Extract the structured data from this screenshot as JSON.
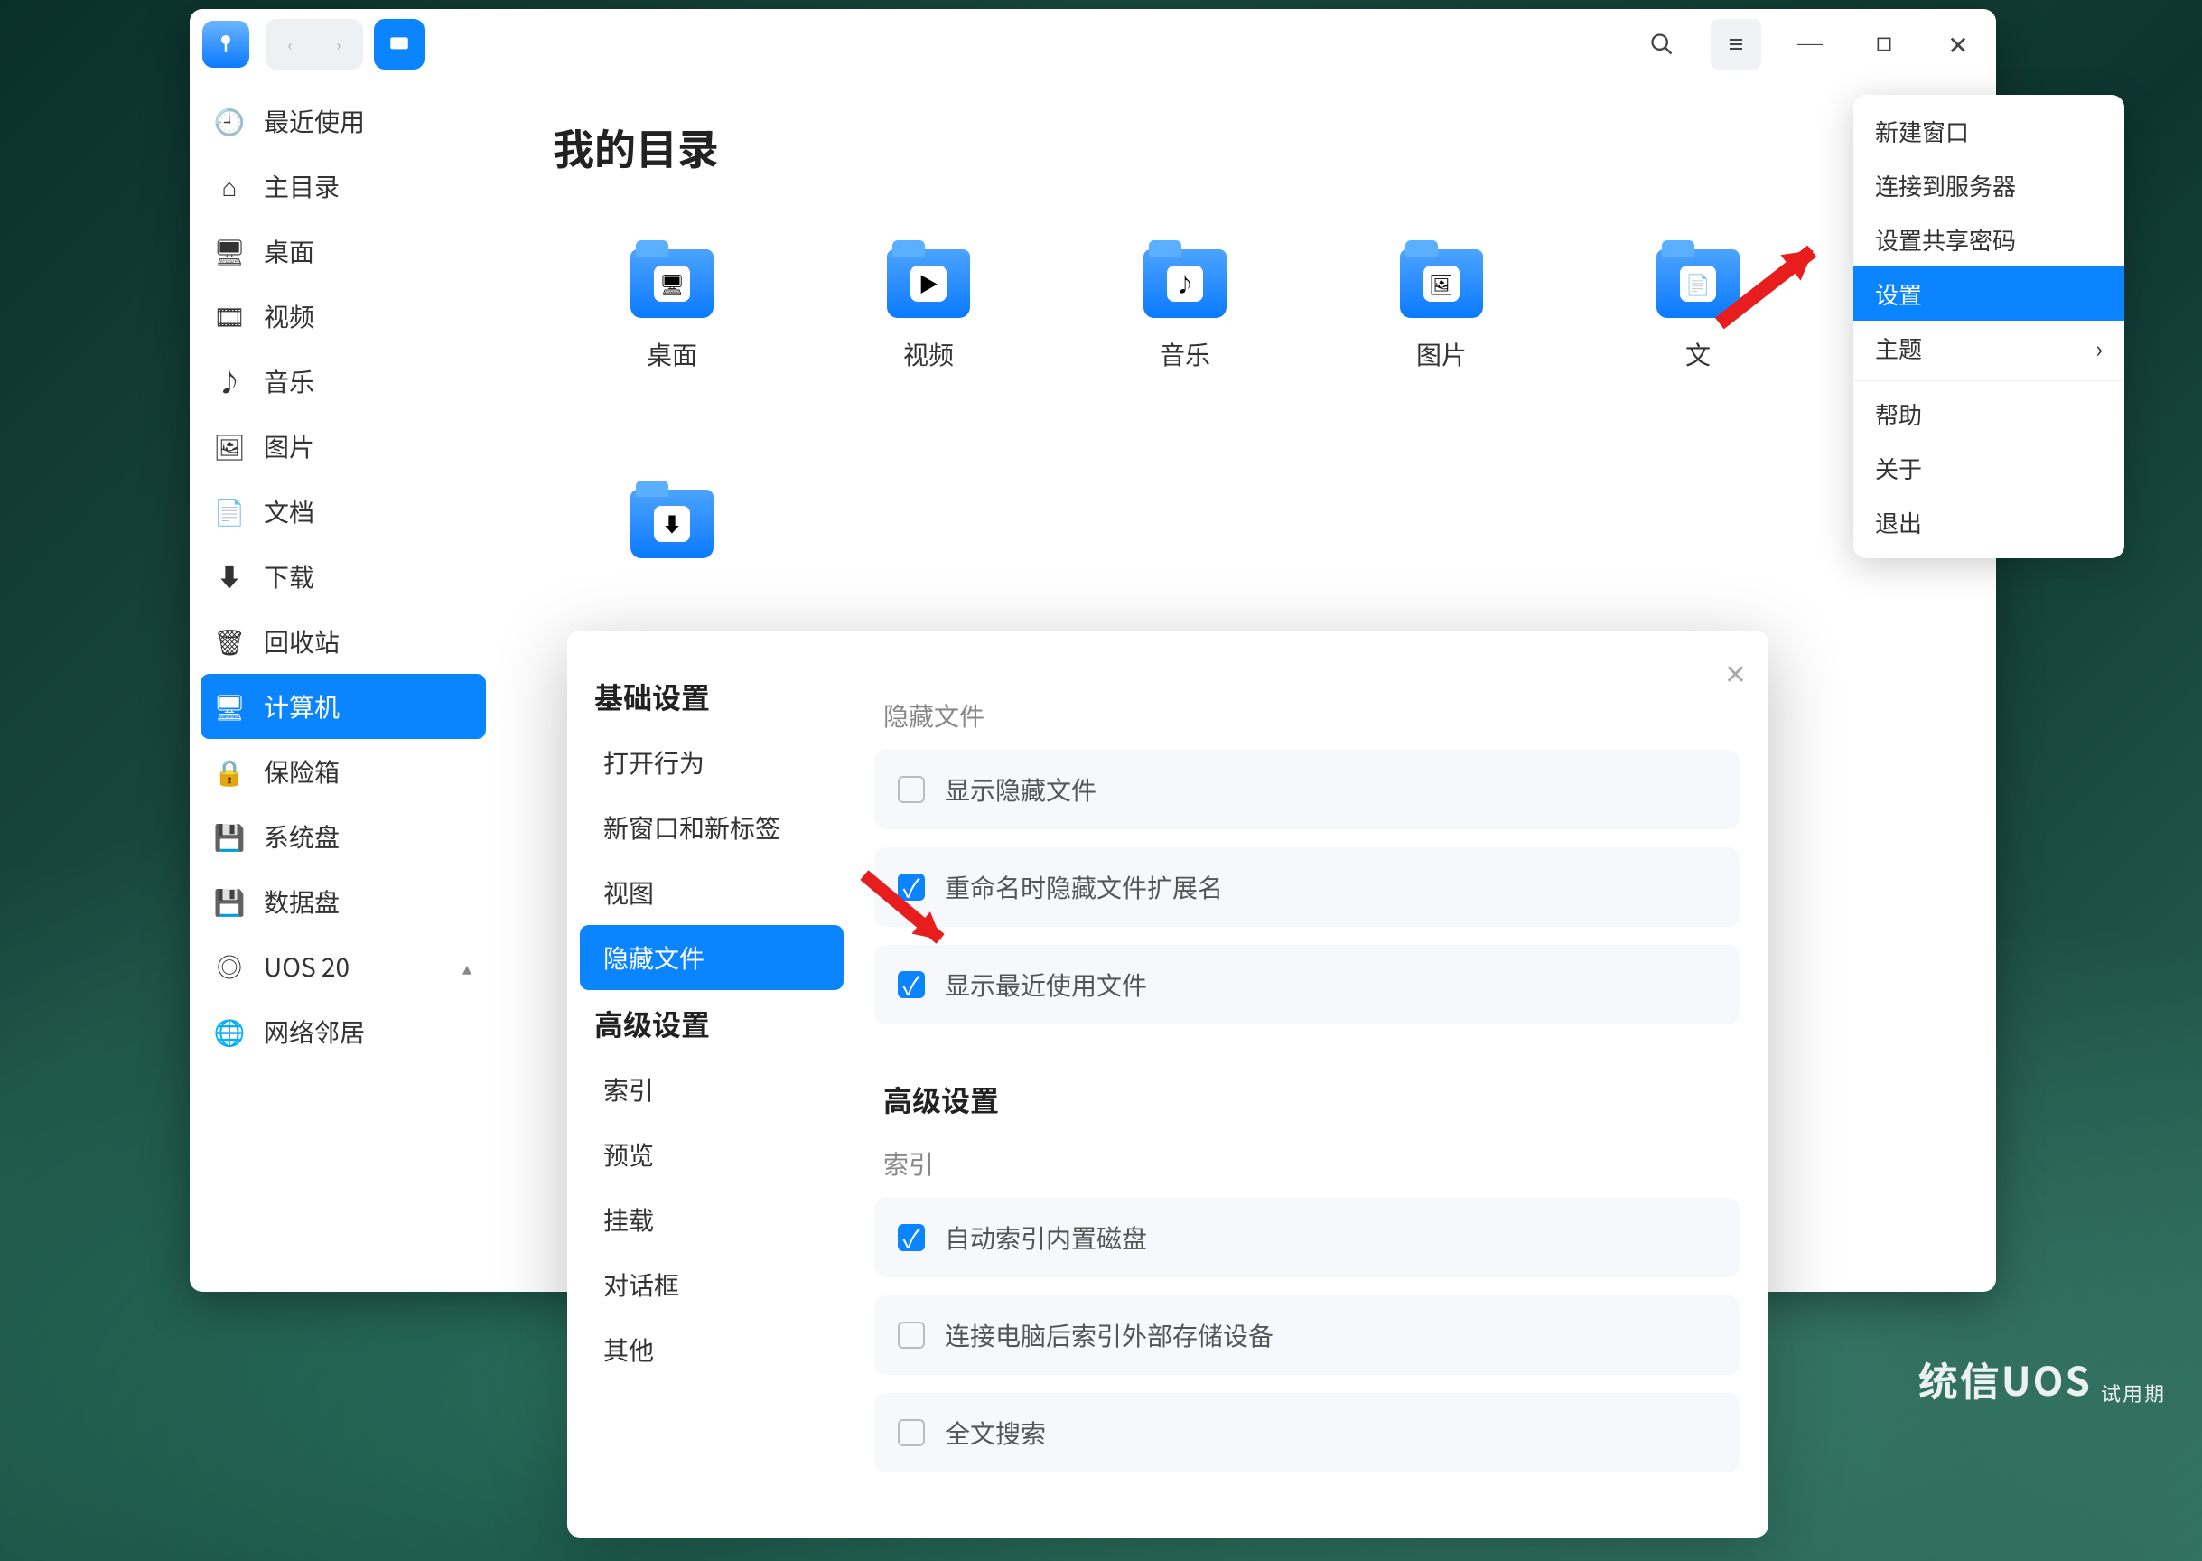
{
  "window_title": "我的目录",
  "sidebar": [
    {
      "label": "最近使用",
      "icon": "clock"
    },
    {
      "label": "主目录",
      "icon": "home"
    },
    {
      "label": "桌面",
      "icon": "desktop"
    },
    {
      "label": "视频",
      "icon": "video"
    },
    {
      "label": "音乐",
      "icon": "music"
    },
    {
      "label": "图片",
      "icon": "image"
    },
    {
      "label": "文档",
      "icon": "doc"
    },
    {
      "label": "下载",
      "icon": "download"
    },
    {
      "label": "回收站",
      "icon": "trash"
    },
    {
      "label": "计算机",
      "icon": "computer",
      "active": true
    },
    {
      "label": "保险箱",
      "icon": "lock"
    },
    {
      "label": "系统盘",
      "icon": "disk"
    },
    {
      "label": "数据盘",
      "icon": "disk"
    },
    {
      "label": "UOS 20",
      "icon": "cd",
      "expand": true
    },
    {
      "label": "网络邻居",
      "icon": "globe"
    }
  ],
  "folders": [
    {
      "label": "桌面",
      "inner": "🖥"
    },
    {
      "label": "视频",
      "inner": "▶"
    },
    {
      "label": "音乐",
      "inner": "♪"
    },
    {
      "label": "图片",
      "inner": "🖼"
    },
    {
      "label": "文",
      "inner": "📄"
    }
  ],
  "downloads_folder_inner": "⬇",
  "dropdown": [
    {
      "label": "新建窗口"
    },
    {
      "label": "连接到服务器"
    },
    {
      "label": "设置共享密码"
    },
    {
      "label": "设置",
      "active": true
    },
    {
      "label": "主题",
      "submenu": true
    },
    {
      "label": "帮助"
    },
    {
      "label": "关于"
    },
    {
      "label": "退出"
    }
  ],
  "settings": {
    "sections": {
      "basic": "基础设置",
      "advanced": "高级设置"
    },
    "basic_items": [
      "打开行为",
      "新窗口和新标签",
      "视图",
      "隐藏文件"
    ],
    "basic_active": "隐藏文件",
    "adv_items": [
      "索引",
      "预览",
      "挂载",
      "对话框",
      "其他"
    ],
    "body": {
      "hidden_h": "隐藏文件",
      "opt1": "显示隐藏文件",
      "opt2": "重命名时隐藏文件扩展名",
      "opt3": "显示最近使用文件",
      "adv_h": "高级设置",
      "index_h": "索引",
      "opt4": "自动索引内置磁盘",
      "opt5": "连接电脑后索引外部存储设备",
      "opt6": "全文搜索"
    }
  },
  "watermark": {
    "brand": "统信UOS",
    "trial": "试用期"
  }
}
